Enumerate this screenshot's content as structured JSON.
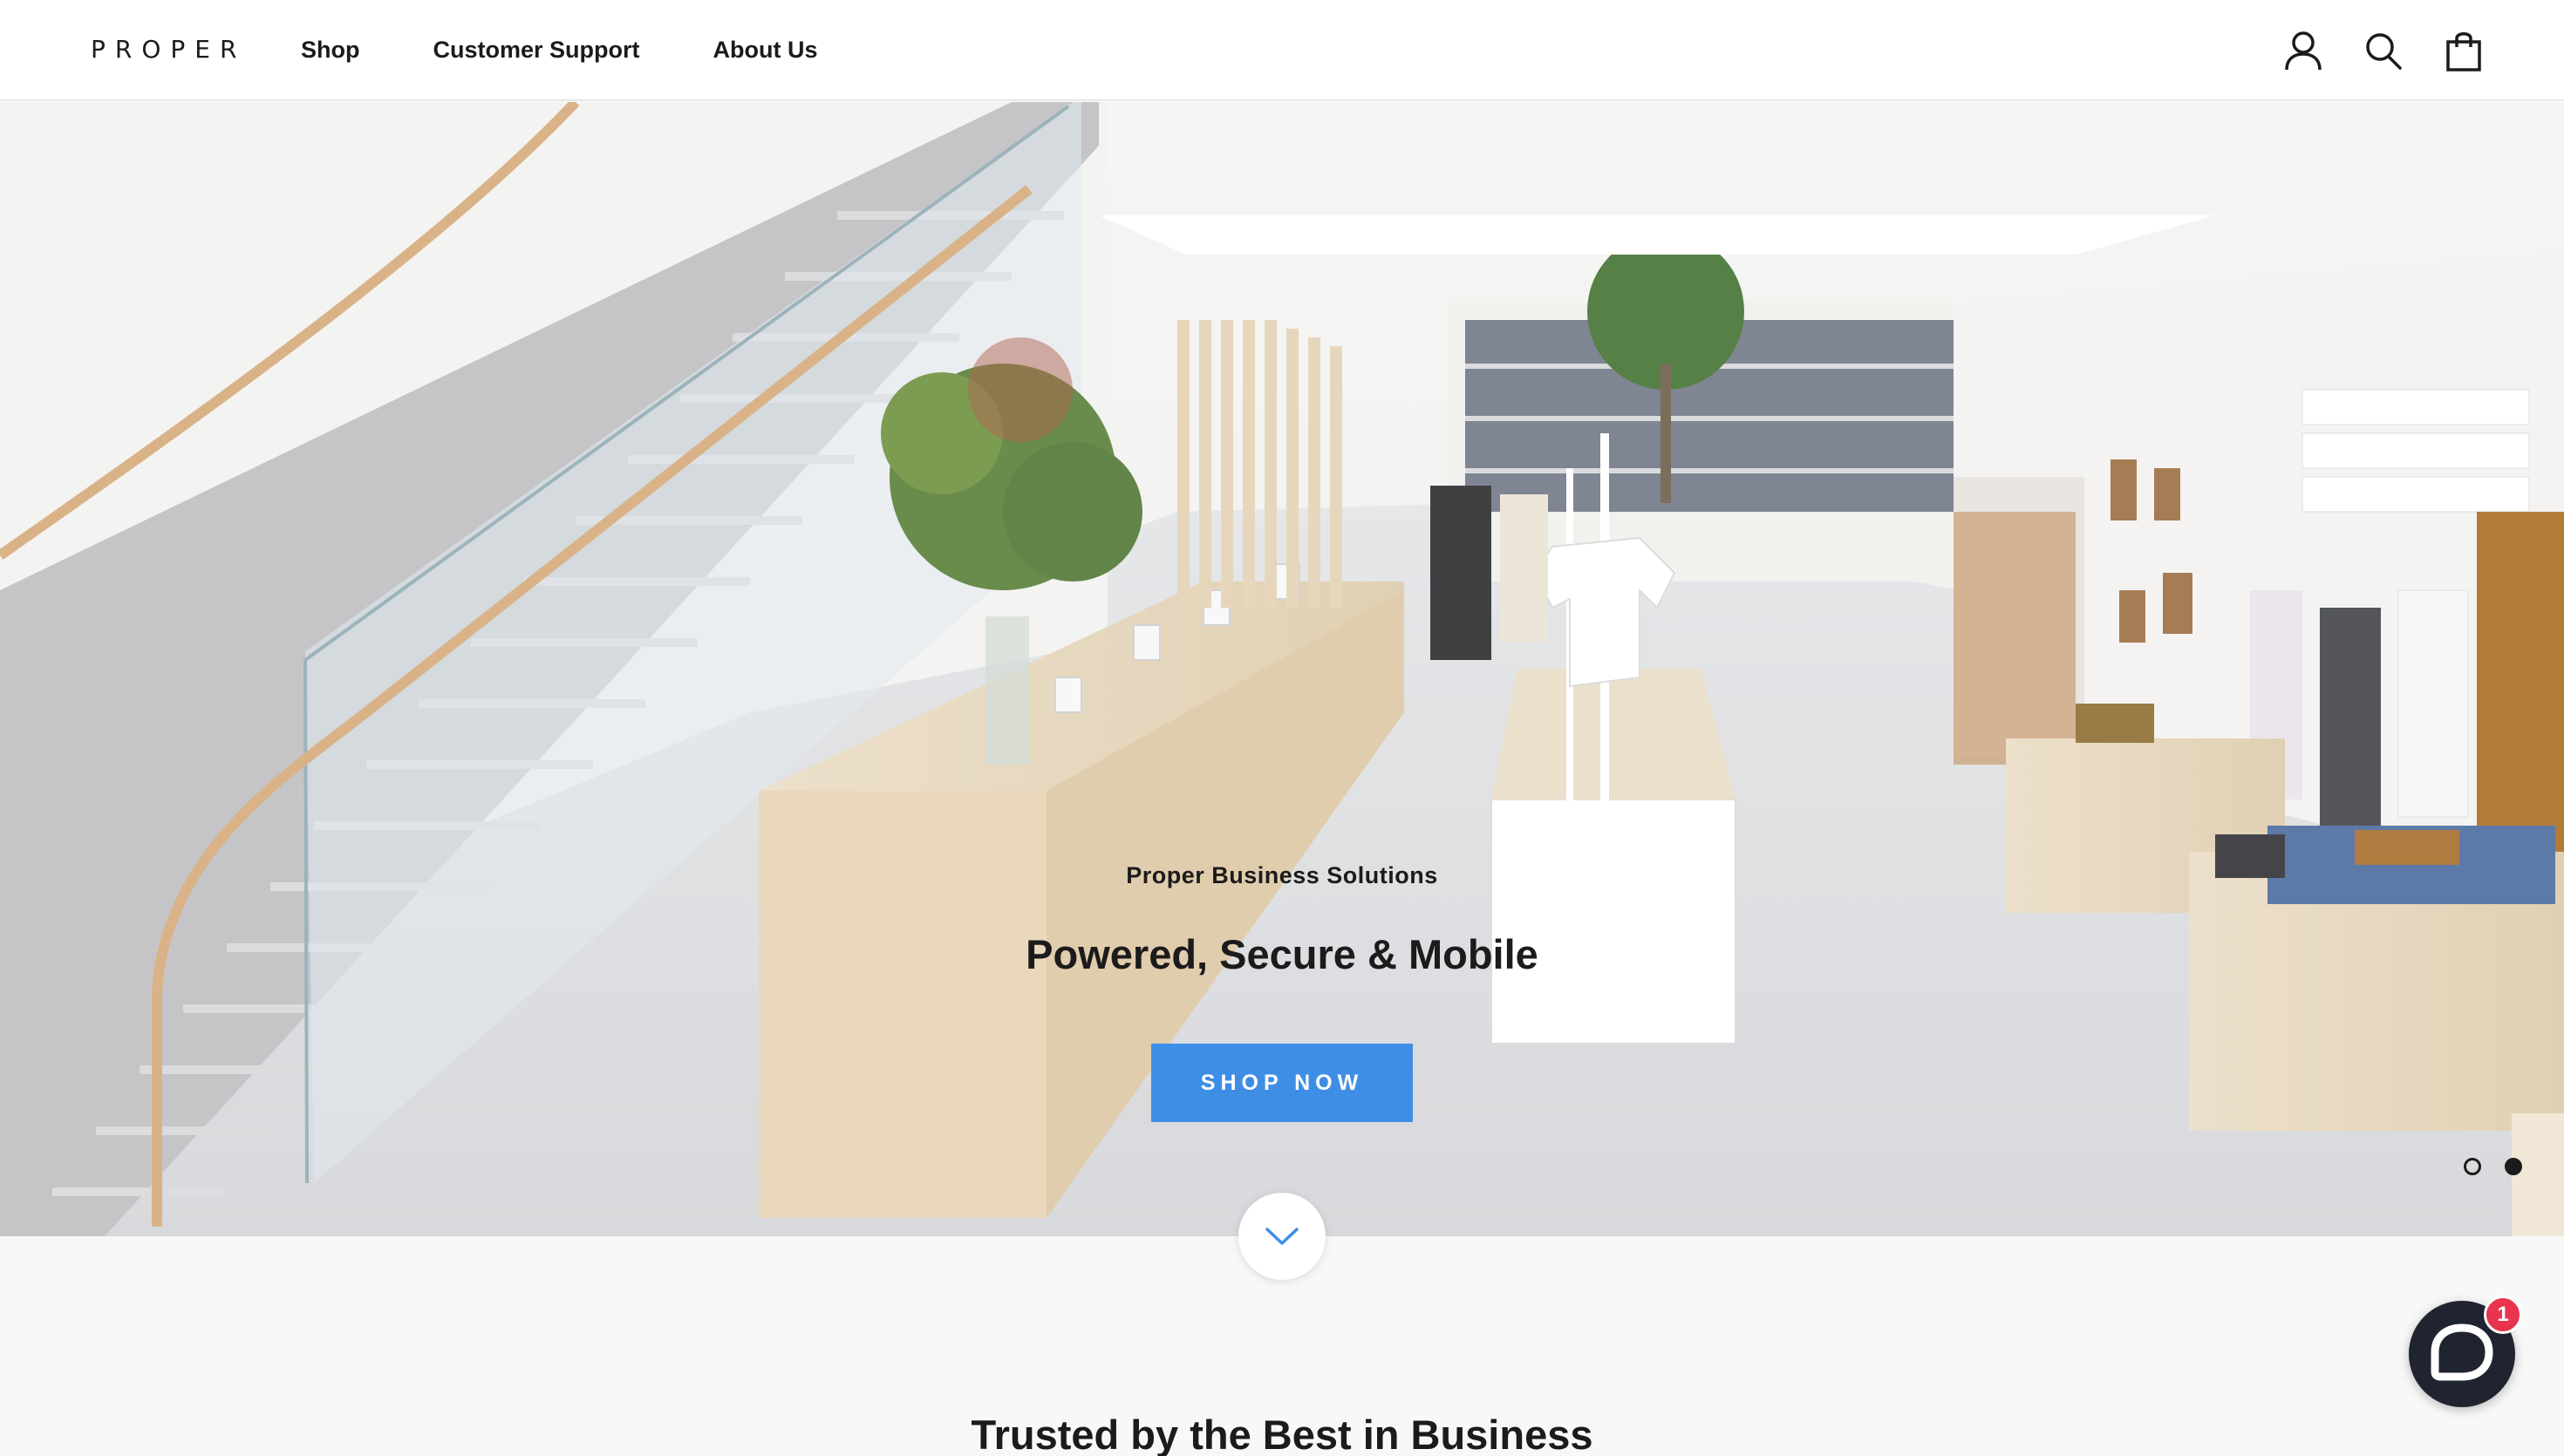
{
  "header": {
    "logo": "PROPER",
    "nav": [
      {
        "label": "Shop"
      },
      {
        "label": "Customer Support"
      },
      {
        "label": "About Us"
      }
    ],
    "icons": [
      "account-icon",
      "search-icon",
      "cart-icon"
    ]
  },
  "hero": {
    "subtitle": "Proper Business Solutions",
    "title": "Powered, Secure & Mobile",
    "button_label": "SHOP NOW",
    "slide_count": 2,
    "active_slide": 2,
    "image_description_icon": "store-interior-photo"
  },
  "section": {
    "title": "Trusted by the Best in Business"
  },
  "chat": {
    "icon": "chat-bubble-icon",
    "badge_count": "1"
  },
  "colors": {
    "accent": "#3e8ee5",
    "text": "#1c1b1b",
    "badge": "#e8344e",
    "chat": "#1f2430"
  }
}
